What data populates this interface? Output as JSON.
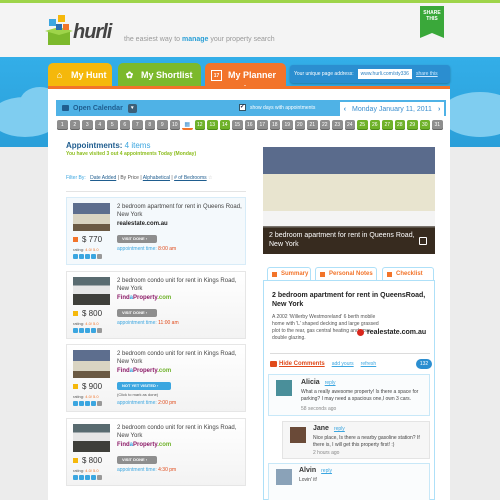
{
  "header": {
    "brand": "hurli",
    "tagline_pre": "the easiest way to ",
    "tagline_em": "manage",
    "tagline_post": " your property search",
    "share_line1": "SHARE",
    "share_line2": "THIS"
  },
  "tabs": [
    {
      "label": "My Hunt",
      "icon": "home-icon",
      "color": "#f5b80b"
    },
    {
      "label": "My Shortlist",
      "icon": "box-icon",
      "color": "#7cb92c"
    },
    {
      "label": "My Planner",
      "icon": "calendar-icon",
      "color": "#f2742a",
      "active": true,
      "icon_text": "17"
    }
  ],
  "page_address": {
    "label": "Your unique page address:",
    "value": "www.hurli.com/sty336",
    "share_link": "share this"
  },
  "calendar_bar": {
    "open_label": "Open Calendar",
    "show_days_label": "show days with appointments",
    "show_days_checked": true,
    "prev": "‹",
    "next": "›",
    "date_label": "Monday  January 11, 2011"
  },
  "days": [
    {
      "n": "1",
      "s": "n"
    },
    {
      "n": "2",
      "s": "n"
    },
    {
      "n": "3",
      "s": "n"
    },
    {
      "n": "4",
      "s": "n"
    },
    {
      "n": "5",
      "s": "n"
    },
    {
      "n": "6",
      "s": "n"
    },
    {
      "n": "7",
      "s": "n"
    },
    {
      "n": "8",
      "s": "n"
    },
    {
      "n": "9",
      "s": "n"
    },
    {
      "n": "10",
      "s": "n"
    },
    {
      "n": "11",
      "s": "today"
    },
    {
      "n": "12",
      "s": "g"
    },
    {
      "n": "13",
      "s": "g"
    },
    {
      "n": "14",
      "s": "g"
    },
    {
      "n": "15",
      "s": "n"
    },
    {
      "n": "16",
      "s": "n"
    },
    {
      "n": "17",
      "s": "n"
    },
    {
      "n": "18",
      "s": "n"
    },
    {
      "n": "19",
      "s": "n"
    },
    {
      "n": "20",
      "s": "n"
    },
    {
      "n": "21",
      "s": "n"
    },
    {
      "n": "22",
      "s": "n"
    },
    {
      "n": "23",
      "s": "n"
    },
    {
      "n": "24",
      "s": "n"
    },
    {
      "n": "25",
      "s": "g"
    },
    {
      "n": "26",
      "s": "g"
    },
    {
      "n": "27",
      "s": "g"
    },
    {
      "n": "28",
      "s": "g"
    },
    {
      "n": "29",
      "s": "g"
    },
    {
      "n": "30",
      "s": "g"
    },
    {
      "n": "31",
      "s": "n"
    }
  ],
  "appointments": {
    "title": "Appointments:",
    "count": "4 items",
    "subtitle": "You have visited 3 out 4 appointments Today (Monday)",
    "filter_label": "Filter By:",
    "filters": [
      "Date Added",
      "By Price",
      "Alphabetical",
      "# of Bedrooms"
    ],
    "items": [
      {
        "title": "2 bedroom apartment for rent in Queens Road, New York",
        "source": "realestate.com.au",
        "price": "$ 770",
        "rating_label": "rating:",
        "rating": "4.0/ 5.0",
        "stars": 4,
        "button": "VISIT DONE  ›",
        "time_label": "appointment time:",
        "time": "8:00 am"
      },
      {
        "title": "2 bedroom condo unit for rent in Kings Road, New York",
        "source": "FindaProperty.com",
        "price": "$ 800",
        "rating_label": "rating:",
        "rating": "4.0/ 5.0",
        "stars": 4,
        "button": "VISIT DONE  ›",
        "time_label": "appointment time:",
        "time": "11:00 am"
      },
      {
        "title": "2 bedroom condo unit for rent in Kings Road, New York",
        "source": "FindaProperty.com",
        "price": "$ 900",
        "rating_label": "rating:",
        "rating": "4.0/ 5.0",
        "stars": 4,
        "button": "NOT YET VISITED  ›",
        "note": "(Click to mark as done)",
        "time_label": "appointment time:",
        "time": "2:00 pm"
      },
      {
        "title": "2 bedroom condo unit for rent in Kings Road, New York",
        "source": "FindaProperty.com",
        "price": "$ 800",
        "rating_label": "rating:",
        "rating": "4.0/ 5.0",
        "stars": 4,
        "button": "VISIT DONE  ›",
        "time_label": "appointment time:",
        "time": "4:30 pm"
      }
    ]
  },
  "detail": {
    "photo_caption": "2 bedroom apartment for rent in Queens Road, New York",
    "tabs": [
      "Summary",
      "Personal Notes",
      "Checklist"
    ],
    "title": "2 bedroom apartment for rent in QueensRoad, New York",
    "description": "A 2002 'Willerby Westmoreland' 6 berth mobile home with 'L' shaped decking and large grassed plot to the rear, gas central heating and upvc double glazing.",
    "source": "realestate.com.au",
    "comments_bar": {
      "hide": "Hide Comments",
      "add": "add yours",
      "refresh": "refresh",
      "count": "132"
    },
    "comments": [
      {
        "name": "Alicia",
        "reply": "reply",
        "text": "What a really awesome property! Is there a space for parking? I may need a spacious one,I own 3 cars.",
        "time": "58 seconds ago"
      },
      {
        "name": "Jane",
        "reply": "reply",
        "text": "Nice place, Is there a nearby gasoline station? If there is, I will get this property first! :)",
        "time": "2 hours ago"
      },
      {
        "name": "Alvin",
        "reply": "reply",
        "text": "Lovin' it!",
        "time": ""
      }
    ]
  }
}
